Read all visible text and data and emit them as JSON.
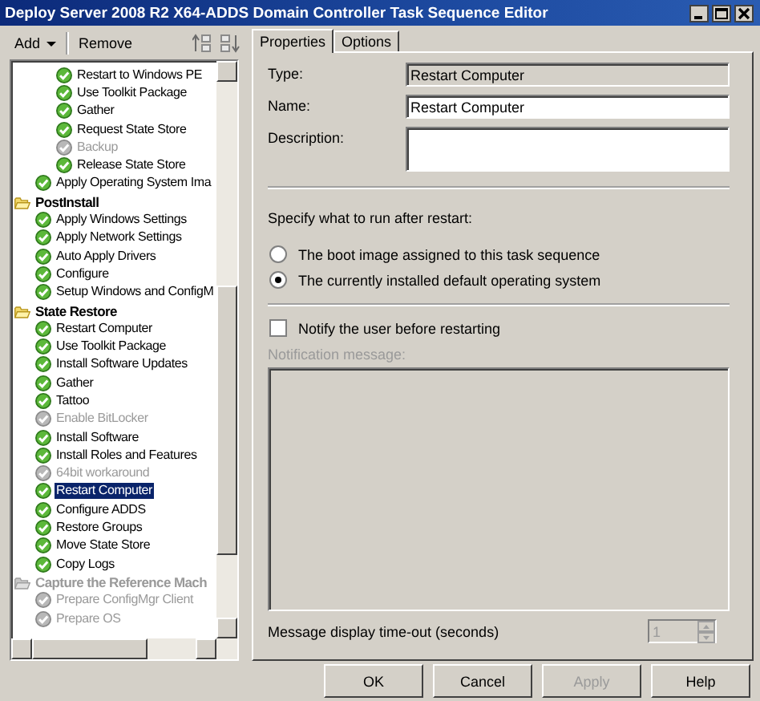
{
  "window": {
    "title": "Deploy Server 2008 R2 X64-ADDS Domain Controller Task Sequence Editor"
  },
  "toolbar": {
    "buttons": [
      {
        "label": "Add",
        "kind": "menu"
      },
      {
        "label": "Remove",
        "kind": "plain"
      }
    ]
  },
  "tree": {
    "items": [
      {
        "children": [
          {
            "children": [
              {
                "kind": "step",
                "label": "Restart to Windows PE",
                "disabled": false,
                "selected": false
              },
              {
                "kind": "step",
                "label": "Use Toolkit Package",
                "disabled": false,
                "selected": false
              },
              {
                "kind": "step",
                "label": "Gather",
                "disabled": false,
                "selected": false
              },
              {
                "kind": "step",
                "label": "Request State Store",
                "disabled": false,
                "selected": false
              },
              {
                "kind": "step",
                "label": "Backup",
                "disabled": true,
                "selected": false
              },
              {
                "kind": "step",
                "label": "Release State Store",
                "disabled": false,
                "selected": false
              }
            ]
          },
          {
            "kind": "step",
            "label": "Apply Operating System Ima",
            "disabled": false,
            "selected": false
          }
        ]
      },
      {
        "kind": "group",
        "label": "PostInstall",
        "disabled": false,
        "selected": false,
        "children": [
          {
            "kind": "step",
            "label": "Apply Windows Settings",
            "disabled": false,
            "selected": false
          },
          {
            "kind": "step",
            "label": "Apply Network Settings",
            "disabled": false,
            "selected": false
          },
          {
            "kind": "step",
            "label": "Auto Apply Drivers",
            "disabled": false,
            "selected": false
          },
          {
            "kind": "step",
            "label": "Configure",
            "disabled": false,
            "selected": false
          },
          {
            "kind": "step",
            "label": "Setup Windows and ConfigM",
            "disabled": false,
            "selected": false
          }
        ]
      },
      {
        "kind": "group",
        "label": "State Restore",
        "disabled": false,
        "selected": false,
        "children": [
          {
            "kind": "step",
            "label": "Restart Computer",
            "disabled": false,
            "selected": false
          },
          {
            "kind": "step",
            "label": "Use Toolkit Package",
            "disabled": false,
            "selected": false
          },
          {
            "kind": "step",
            "label": "Install Software Updates",
            "disabled": false,
            "selected": false
          },
          {
            "kind": "step",
            "label": "Gather",
            "disabled": false,
            "selected": false
          },
          {
            "kind": "step",
            "label": "Tattoo",
            "disabled": false,
            "selected": false
          },
          {
            "kind": "step",
            "label": "Enable BitLocker",
            "disabled": true,
            "selected": false
          },
          {
            "kind": "step",
            "label": "Install Software",
            "disabled": false,
            "selected": false
          },
          {
            "kind": "step",
            "label": "Install Roles and Features",
            "disabled": false,
            "selected": false
          },
          {
            "kind": "step",
            "label": "64bit workaround",
            "disabled": true,
            "selected": false
          },
          {
            "kind": "step",
            "label": "Restart Computer",
            "disabled": false,
            "selected": true
          },
          {
            "kind": "step",
            "label": "Configure ADDS",
            "disabled": false,
            "selected": false
          },
          {
            "kind": "step",
            "label": "Restore Groups",
            "disabled": false,
            "selected": false
          },
          {
            "kind": "step",
            "label": "Move State Store",
            "disabled": false,
            "selected": false
          },
          {
            "kind": "step",
            "label": "Copy Logs",
            "disabled": false,
            "selected": false
          }
        ]
      },
      {
        "kind": "group",
        "label": "Capture the Reference Mach",
        "disabled": true,
        "selected": false,
        "children": [
          {
            "kind": "step",
            "label": "Prepare ConfigMgr Client",
            "disabled": true,
            "selected": false
          },
          {
            "kind": "step",
            "label": "Prepare OS",
            "disabled": true,
            "selected": false
          }
        ]
      }
    ]
  },
  "tabs": [
    {
      "label": "Properties",
      "selected": true
    },
    {
      "label": "Options",
      "selected": false
    }
  ],
  "properties": {
    "type": {
      "label": "Type:",
      "value": "Restart Computer"
    },
    "name": {
      "label": "Name:",
      "value": "Restart Computer"
    },
    "description": {
      "label": "Description:"
    },
    "restart_prompt": "Specify what to run after restart:",
    "restart_options": [
      {
        "label": "The boot image assigned to this task sequence",
        "selected": false
      },
      {
        "label": "The currently installed default operating system",
        "selected": true
      }
    ],
    "notify": {
      "label": "Notify the user before restarting",
      "checked": false
    },
    "notification_message": {
      "label": "Notification message:",
      "disabled": true
    },
    "timeout": {
      "label": "Message display time-out (seconds)",
      "value": "1",
      "disabled": true
    }
  },
  "buttons": [
    {
      "label": "OK",
      "disabled": false
    },
    {
      "label": "Cancel",
      "disabled": false
    },
    {
      "label": "Apply",
      "disabled": true
    },
    {
      "label": "Help",
      "disabled": false
    }
  ]
}
